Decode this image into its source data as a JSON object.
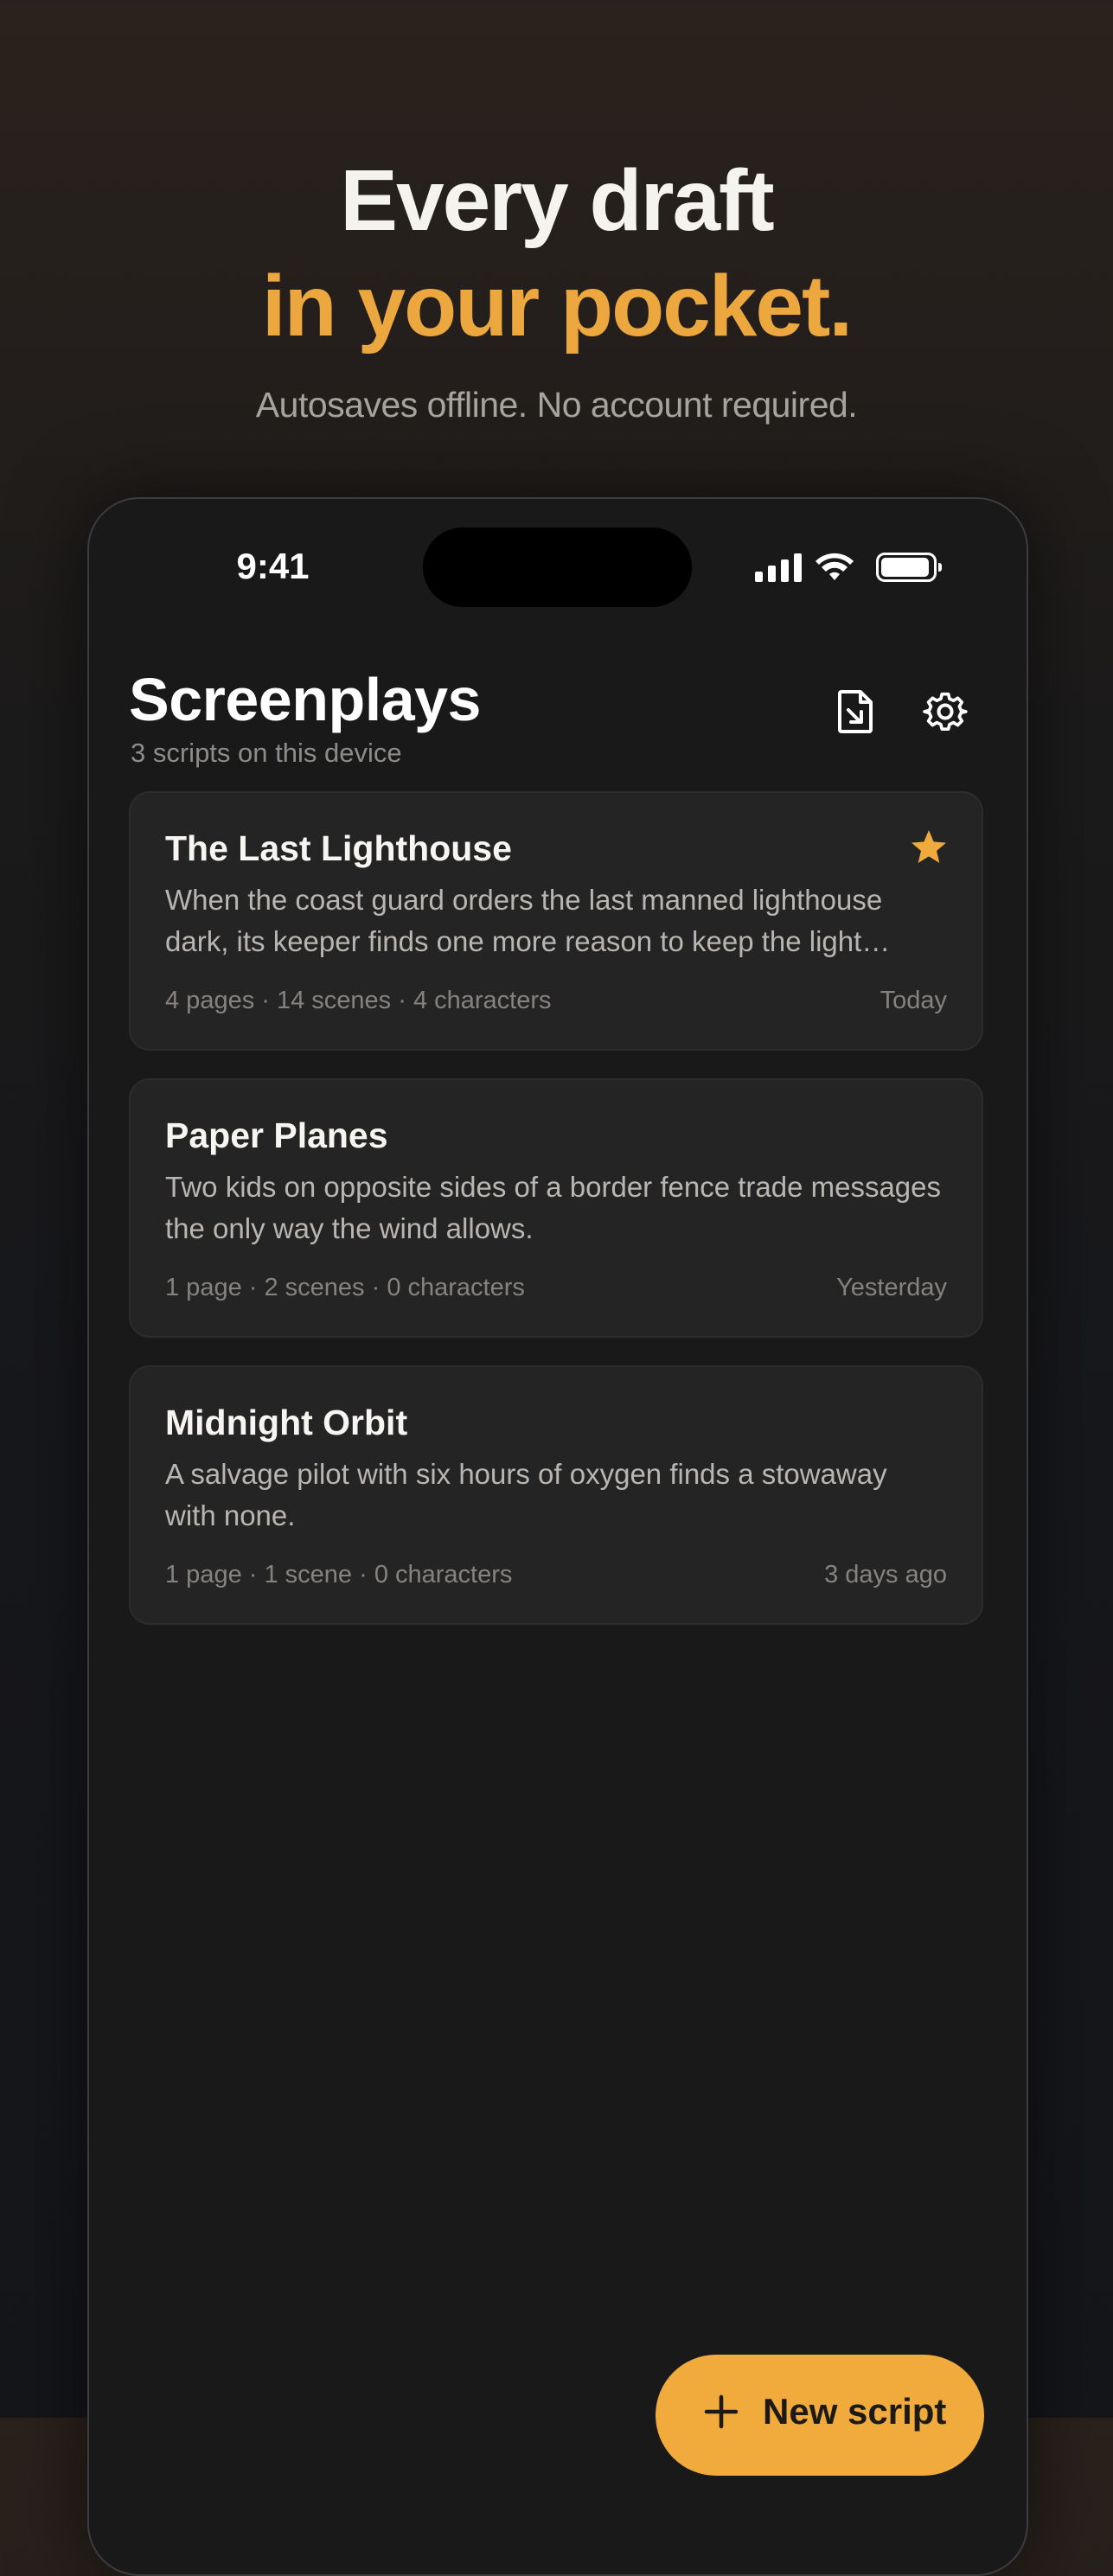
{
  "hero": {
    "headline_line1": "Every draft",
    "headline_line2": "in your pocket.",
    "subtitle": "Autosaves offline. No account required."
  },
  "status_bar": {
    "time": "9:41",
    "signal_icon": "cellular-signal-icon",
    "wifi_icon": "wifi-icon",
    "battery_icon": "battery-icon",
    "battery_level": 0.95
  },
  "header": {
    "title": "Screenplays",
    "subtitle": "3 scripts on this device",
    "import_icon": "import-document-icon",
    "settings_icon": "gear-icon"
  },
  "scripts": [
    {
      "title": "The Last Lighthouse",
      "description": "When the coast guard orders the last manned lighthouse dark, its keeper finds one more reason to keep the light burning.",
      "meta": "4 pages · 14 scenes · 4 characters",
      "date": "Today",
      "starred": true
    },
    {
      "title": "Paper Planes",
      "description": "Two kids on opposite sides of a border fence trade messages the only way the wind allows.",
      "meta": "1 page · 2 scenes · 0 characters",
      "date": "Yesterday",
      "starred": false
    },
    {
      "title": "Midnight Orbit",
      "description": "A salvage pilot with six hours of oxygen finds a stowaway with none.",
      "meta": "1 page · 1 scene · 0 characters",
      "date": "3 days ago",
      "starred": false
    }
  ],
  "fab": {
    "label": "New script",
    "icon": "plus-icon"
  },
  "colors": {
    "accent": "#eca73f",
    "fab": "#f0ab3c",
    "card": "#242424",
    "device": "#191919"
  }
}
